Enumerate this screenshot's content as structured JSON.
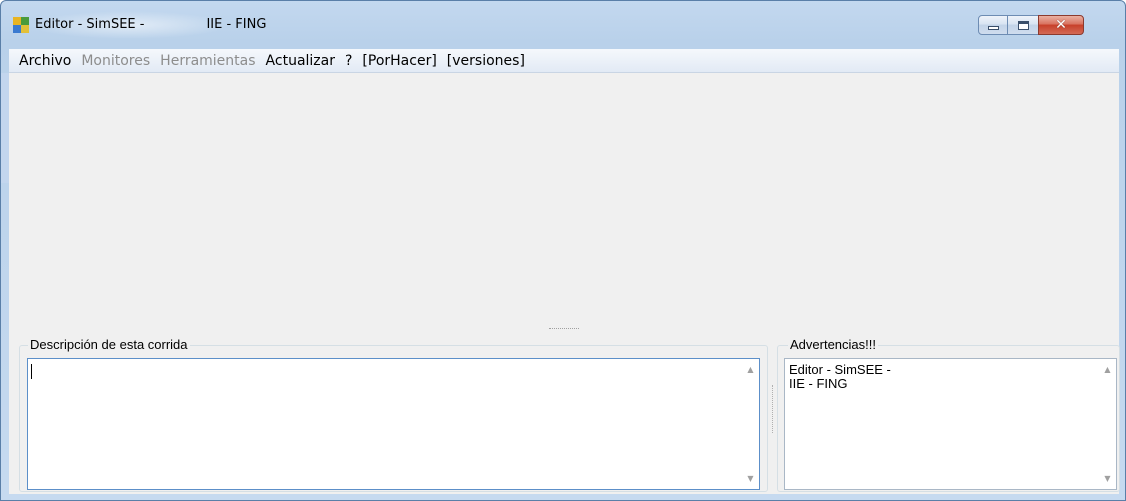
{
  "window": {
    "title": "Editor - SimSEE -               IIE - FING",
    "controls": {
      "minimize": "minimize",
      "maximize": "maximize",
      "close": "✕"
    }
  },
  "menubar": {
    "items": [
      {
        "label": "Archivo",
        "enabled": true
      },
      {
        "label": "Monitores",
        "enabled": false
      },
      {
        "label": "Herramientas",
        "enabled": false
      },
      {
        "label": "Actualizar",
        "enabled": true
      },
      {
        "label": "?",
        "enabled": true
      },
      {
        "label": "[PorHacer]",
        "enabled": true
      },
      {
        "label": "[versiones]",
        "enabled": true
      }
    ]
  },
  "description_panel": {
    "title": "Descripción de esta corrida",
    "text": ""
  },
  "warnings_panel": {
    "title": "Advertencias!!!",
    "text": "Editor - SimSEE -\nIIE - FING"
  },
  "icons": {
    "app": "simsee-app-icon",
    "scroll_up": "▲",
    "scroll_down": "▼"
  },
  "colors": {
    "titlebar": "#b9d1ea",
    "client_background": "#f0f0f0",
    "close_button": "#c7402a",
    "disabled_menu_text": "#8d8d8d"
  }
}
